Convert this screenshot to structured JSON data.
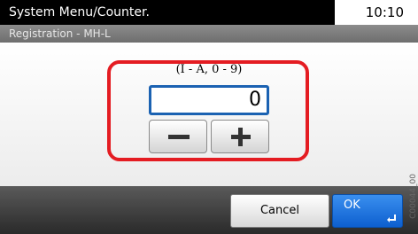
{
  "header": {
    "title": "System Menu/Counter.",
    "time": "10:10",
    "subtitle": "Registration - MH-L"
  },
  "entry": {
    "range_hint": "(I - A, 0 - 9)",
    "value": "0",
    "minus_icon": "minus-icon",
    "plus_icon": "plus-icon"
  },
  "footer": {
    "cancel_label": "Cancel",
    "ok_label": "OK",
    "enter_icon": "enter-arrow-icon"
  },
  "side_code": "C00044_00",
  "colors": {
    "title_bg": "#000000",
    "highlight": "#e41c22",
    "field_border": "#1b62b2",
    "ok_bg": "#0d5fcf"
  }
}
